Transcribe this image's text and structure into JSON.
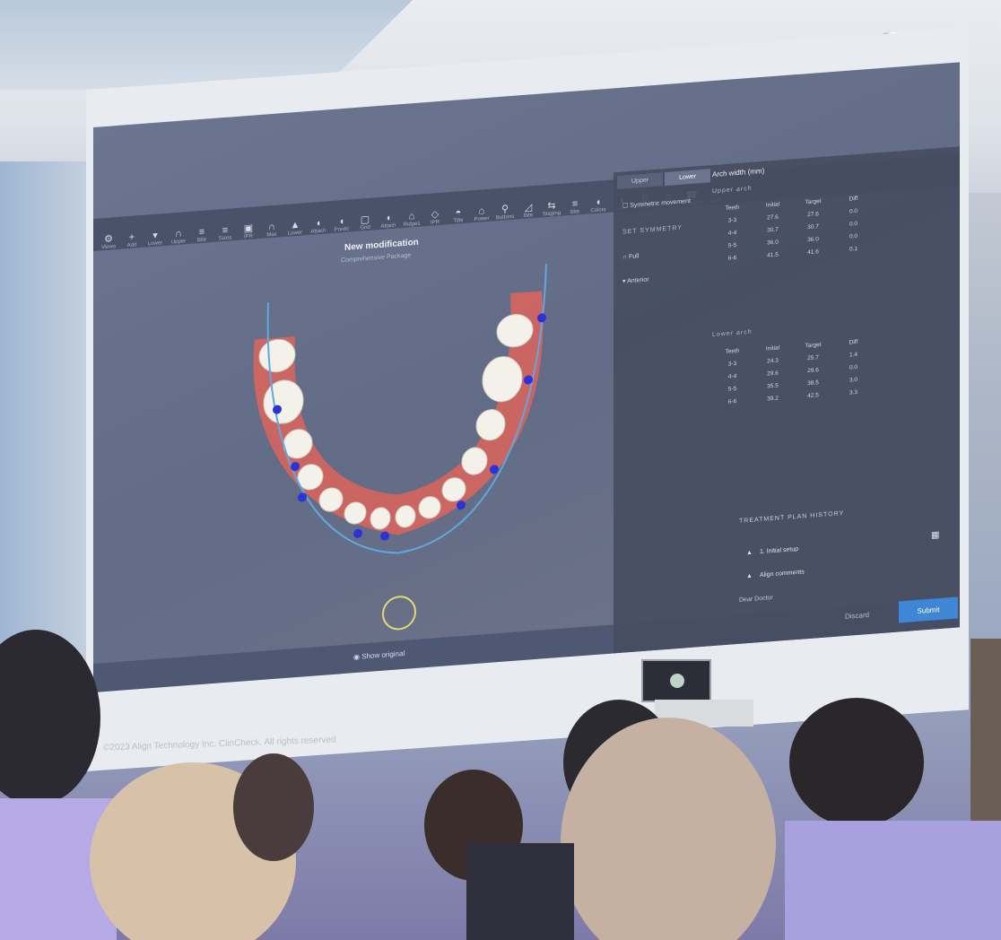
{
  "toolbar": {
    "items": [
      {
        "icon": "settings-icon",
        "label": "Views"
      },
      {
        "icon": "plus-icon",
        "label": "Add"
      },
      {
        "icon": "chevron-down-icon",
        "label": "Lower"
      },
      {
        "icon": "arch-icon",
        "label": "Upper"
      },
      {
        "icon": "bars-icon",
        "label": "Bite"
      },
      {
        "icon": "bars-icon",
        "label": "Sizes"
      },
      {
        "icon": "cube-icon",
        "label": "IPR"
      },
      {
        "icon": "arch-icon",
        "label": "Max"
      },
      {
        "icon": "triangle-icon",
        "label": "Lower"
      },
      {
        "icon": "tooth-icon",
        "label": "Attach"
      },
      {
        "icon": "tooth-icon",
        "label": "Pontic"
      },
      {
        "icon": "square-icon",
        "label": "Grid"
      },
      {
        "icon": "tooth-icon",
        "label": "Attach"
      },
      {
        "icon": "bell-icon",
        "label": "Ridges"
      },
      {
        "icon": "diamond-icon",
        "label": "IPR"
      },
      {
        "icon": "fan-icon",
        "label": "Tilts"
      },
      {
        "icon": "bell-icon",
        "label": "Power"
      },
      {
        "icon": "pin-icon",
        "label": "Buttons"
      },
      {
        "icon": "ramp-icon",
        "label": "Bite"
      },
      {
        "icon": "staging-icon",
        "label": "Staging"
      },
      {
        "icon": "bars-icon",
        "label": "Bite"
      },
      {
        "icon": "tooth-icon",
        "label": "Colors"
      },
      {
        "icon": "tooth-icon",
        "label": "Align"
      },
      {
        "icon": "b-icon",
        "label": "Button"
      },
      {
        "icon": "arch-icon",
        "label": "Arch"
      },
      {
        "icon": "phone-icon",
        "label": "Occlusal"
      },
      {
        "icon": "circle-icon",
        "label": "Teeth"
      }
    ]
  },
  "modal": {
    "title": "New modification",
    "subtitle": "Comprehensive Package",
    "show_original": "Show original"
  },
  "panel": {
    "tabs": [
      "Upper",
      "Lower"
    ],
    "symmetric": "Symmetric movement",
    "set_symmetry": "SET SYMMETRY",
    "full": "Full",
    "anterior": "Anterior",
    "arch_width_title": "Arch width (mm)",
    "upper_arch": "Upper arch",
    "lower_arch": "Lower arch",
    "upper_headers": [
      "Teeth",
      "Initial",
      "Target",
      "Diff"
    ],
    "upper_rows": [
      [
        "3-3",
        "27.6",
        "27.6",
        "0.0"
      ],
      [
        "4-4",
        "30.7",
        "30.7",
        "0.0"
      ],
      [
        "5-5",
        "36.0",
        "36.0",
        "0.0"
      ],
      [
        "6-6",
        "41.5",
        "41.6",
        "0.1"
      ]
    ],
    "lower_headers": [
      "Teeth",
      "Initial",
      "Target",
      "Diff"
    ],
    "lower_rows": [
      [
        "3-3",
        "24.3",
        "25.7",
        "1.4"
      ],
      [
        "4-4",
        "29.6",
        "29.6",
        "0.0"
      ],
      [
        "5-5",
        "35.5",
        "38.5",
        "3.0"
      ],
      [
        "6-6",
        "39.2",
        "42.5",
        "3.3"
      ]
    ]
  },
  "history": {
    "title": "TREATMENT PLAN HISTORY",
    "items": [
      "1. Initial setup",
      "Align comments"
    ],
    "dear": "Dear Doctor",
    "discard": "Discard",
    "submit": "Submit"
  },
  "footer": {
    "copyright": "©2023 Align Technology Inc. ClinCheck. All rights reserved"
  }
}
